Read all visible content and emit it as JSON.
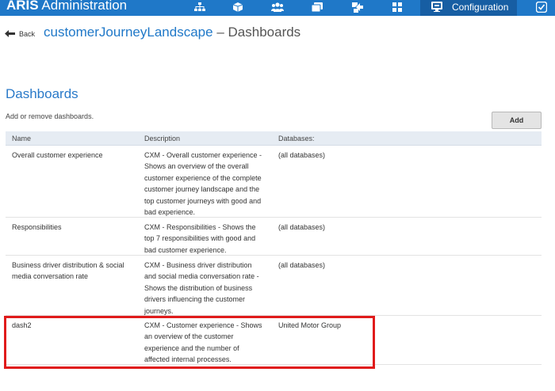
{
  "app": {
    "brand_bold": "ARIS",
    "brand_rest": "Administration",
    "nav_icons": [
      "hierarchy-icon",
      "cube-icon",
      "users-icon",
      "database-icon",
      "document-arrow-icon",
      "grid-icon"
    ],
    "config_label": "Configuration",
    "colors": {
      "topbar": "#1f78c8",
      "active_tab": "#175ea3",
      "accent_text": "#2a7ac9",
      "highlight": "#e01b1b"
    }
  },
  "header": {
    "back_label": "Back",
    "app_name": "customerJourneyLandscape",
    "separator": "–",
    "page": "Dashboards"
  },
  "section": {
    "title": "Dashboards",
    "subtitle": "Add or remove dashboards.",
    "add_label": "Add"
  },
  "table": {
    "columns": [
      "Name",
      "Description",
      "Databases:"
    ],
    "rows": [
      {
        "name": "Overall customer experience",
        "description": "CXM - Overall customer experience - Shows an overview of the overall customer experience of the complete customer journey landscape and the top customer journeys with good and bad experience.",
        "databases": "(all databases)"
      },
      {
        "name": "Responsibilities",
        "description": "CXM - Responsibilities - Shows the top 7 responsibilities with good and bad customer experience.",
        "databases": "(all databases)"
      },
      {
        "name": "Business driver distribution & social media conversation rate",
        "description": "CXM - Business driver distribution and social media conversation rate - Shows the distribution of business drivers influencing the customer journeys.",
        "databases": "(all databases)"
      },
      {
        "name": "dash2",
        "description": "CXM - Customer experience - Shows an overview of the customer experience and the number of affected internal processes.",
        "databases": "United Motor Group"
      }
    ]
  }
}
